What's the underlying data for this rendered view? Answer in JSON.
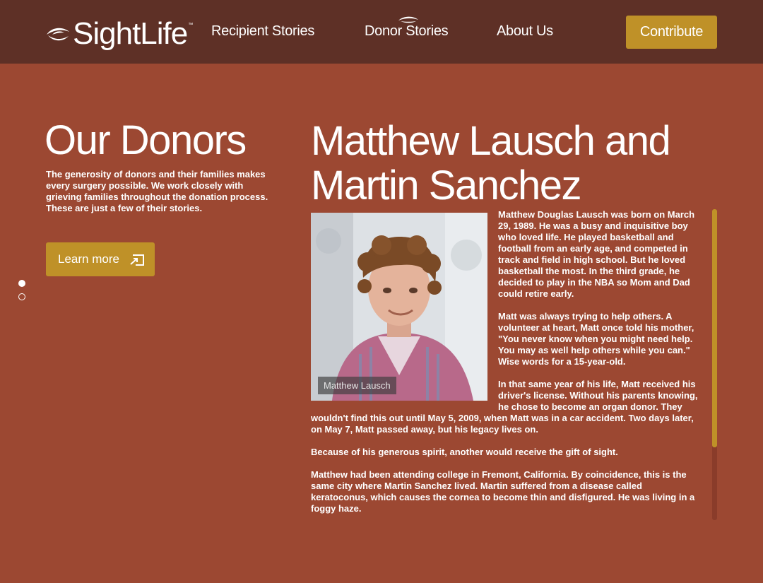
{
  "brand": {
    "name": "SightLife",
    "trademark": "™",
    "logo_icon": "eye-swoosh-icon",
    "colors": {
      "header": "#5e3026",
      "background": "#9c4832",
      "accent": "#bf9128",
      "text": "#ffffff"
    }
  },
  "nav": {
    "items": [
      {
        "label": "Recipient Stories"
      },
      {
        "label": "Donor Stories",
        "active": true
      },
      {
        "label": "About Us"
      }
    ],
    "cta": "Contribute"
  },
  "sidebar": {
    "title": "Our Donors",
    "intro": "The generosity of donors and their families makes every surgery possible. We work closely with grieving families throughout the donation process. These are just a few of their stories.",
    "button": "Learn more",
    "button_icon": "external-link-icon",
    "slides": {
      "count": 2,
      "active": 1
    }
  },
  "story": {
    "title": "Matthew Lausch and Martin Sanchez",
    "photo_caption": "Matthew Lausch",
    "paragraphs": [
      "Matthew Douglas Lausch was born on March 29, 1989. He was a busy and inquisitive boy who loved life. He played basketball and football from an early age, and competed in track and field in high school. But he loved basketball the most. In the third grade, he decided to play in the NBA so Mom and Dad could retire early.",
      "Matt was always trying to help others. A volunteer at heart, Matt once told his mother, \"You never know when you might need help. You may as well help others while you can.\" Wise words for a 15-year-old.",
      "In that same year of his life, Matt received his driver's license. Without his parents knowing, he chose to become an organ donor. They wouldn't find this out until May 5, 2009, when Matt was in a car accident. Two days later, on May 7, Matt passed away, but his legacy lives on.",
      "Because of his generous spirit, another would receive the gift of sight.",
      "Matthew had been attending college in Fremont, California. By coincidence, this is the same city where Martin Sanchez lived. Martin suffered from a disease called keratoconus, which causes the cornea to become thin and disfigured. He was living in a foggy haze."
    ]
  }
}
